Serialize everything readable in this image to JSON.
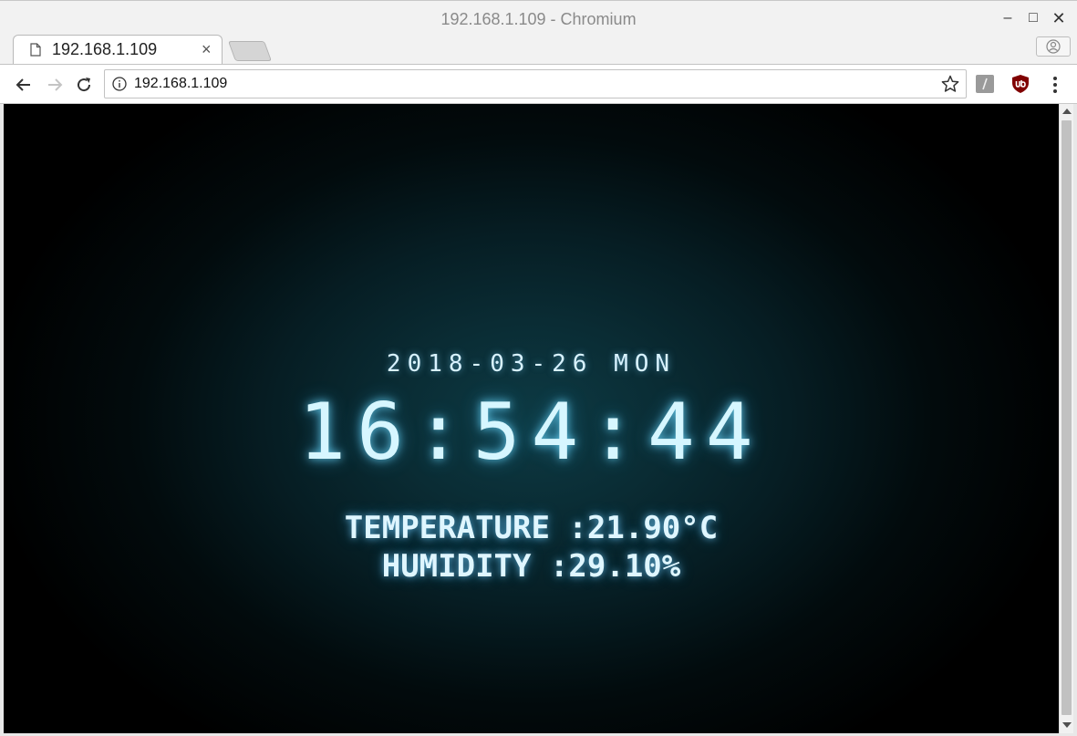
{
  "window": {
    "title": "192.168.1.109 - Chromium"
  },
  "tab": {
    "title": "192.168.1.109",
    "close": "×"
  },
  "window_controls": {
    "minimize": "–",
    "maximize": "□",
    "close": "✕"
  },
  "toolbar": {
    "url": "192.168.1.109"
  },
  "page": {
    "date": "2018-03-26 MON",
    "time": "16:54:44",
    "temperature": "TEMPERATURE :21.90°C",
    "humidity": "HUMIDITY :29.10%"
  },
  "colors": {
    "glow": "#6edcff",
    "text": "#d6f6ff",
    "background": "#000000"
  }
}
